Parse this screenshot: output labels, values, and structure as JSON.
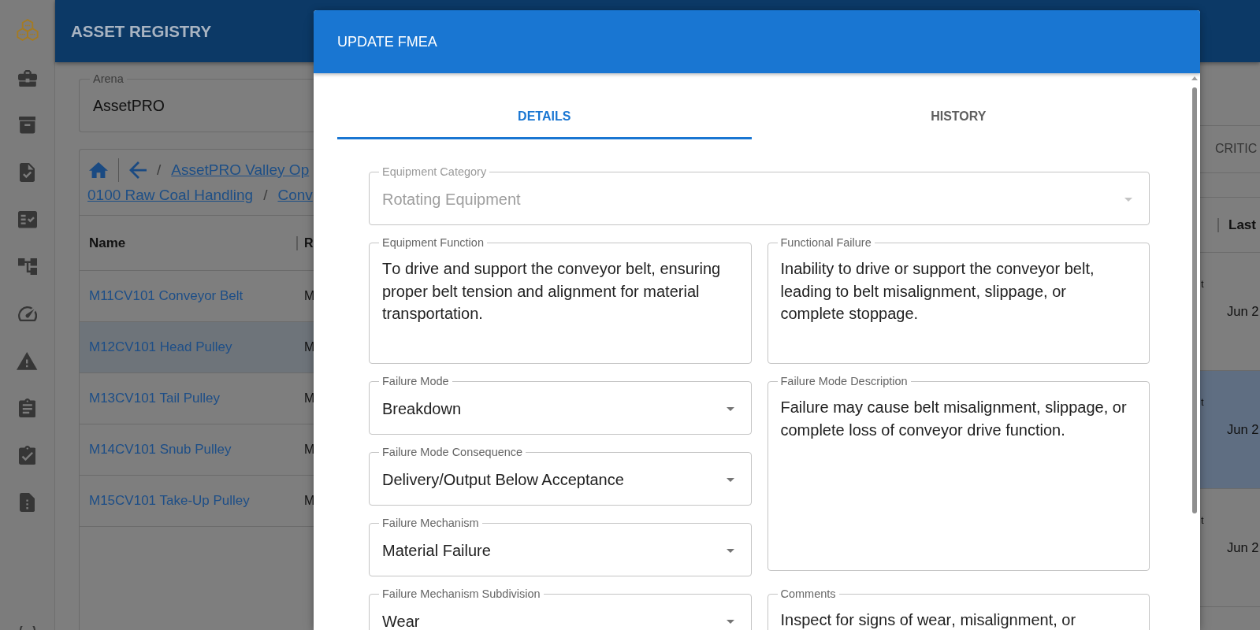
{
  "app_bar": {
    "title": "ASSET REGISTRY"
  },
  "arena": {
    "label": "Arena",
    "value": "AssetPRO"
  },
  "breadcrumb": {
    "lines": [
      [
        {
          "kind": "separator",
          "text": "/"
        },
        {
          "kind": "link",
          "text": "AssetPRO Valley Op"
        }
      ],
      [
        {
          "kind": "link",
          "text": "0100 Raw Coal Handling"
        },
        {
          "kind": "separator",
          "text": "/"
        },
        {
          "kind": "link",
          "text": "Conv"
        }
      ]
    ]
  },
  "asset_table": {
    "columns": [
      "Name",
      "R"
    ],
    "rows": [
      {
        "cells": [
          "M11CV101 Conveyor Belt",
          "M"
        ],
        "selected": false
      },
      {
        "cells": [
          "M12CV101 Head Pulley",
          "M"
        ],
        "selected": true
      },
      {
        "cells": [
          "M13CV101 Tail Pulley",
          "M"
        ],
        "selected": false
      },
      {
        "cells": [
          "M14CV101 Snub Pulley",
          "M"
        ],
        "selected": false
      },
      {
        "cells": [
          "M15CV101 Take-Up Pulley",
          "M"
        ],
        "selected": false
      }
    ]
  },
  "side_panel": {
    "tabs": [
      {
        "label": "CRITIC",
        "selected": false
      }
    ],
    "columns": [
      "",
      "Last"
    ],
    "rows": [
      {
        "cells": [
          "t",
          "Jun 2"
        ],
        "selected": false
      },
      {
        "cells": [
          "t",
          "Jun 2"
        ],
        "selected": true
      },
      {
        "cells": [
          "t",
          "Jun 2"
        ],
        "selected": false
      }
    ]
  },
  "dialog": {
    "title": "UPDATE FMEA",
    "tabs": [
      {
        "label": "DETAILS",
        "selected": true
      },
      {
        "label": "HISTORY",
        "selected": false
      }
    ],
    "sections": [
      {
        "kind": "full",
        "fields": [
          {
            "kind": "select",
            "label": "Equipment Category",
            "value": "Rotating Equipment",
            "disabled": true
          }
        ]
      },
      {
        "kind": "columns",
        "left": [
          {
            "kind": "textarea",
            "label": "Equipment Function",
            "value": "To drive and support the conveyor belt, ensuring proper belt tension and alignment for material transportation.",
            "disabled": false
          }
        ],
        "right": [
          {
            "kind": "textarea",
            "label": "Functional Failure",
            "value": "Inability to drive or support the conveyor belt, leading to belt misalignment, slippage, or complete stoppage.",
            "disabled": false
          }
        ]
      },
      {
        "kind": "columns",
        "left": [
          {
            "kind": "select",
            "label": "Failure Mode",
            "value": "Breakdown",
            "disabled": false
          },
          {
            "kind": "select",
            "label": "Failure Mode Consequence",
            "value": "Delivery/Output Below Acceptance",
            "disabled": false
          },
          {
            "kind": "select",
            "label": "Failure Mechanism",
            "value": "Material Failure",
            "disabled": false
          },
          {
            "kind": "select",
            "label": "Failure Mechanism Subdivision",
            "value": "Wear",
            "disabled": false
          }
        ],
        "right": [
          {
            "kind": "textarea",
            "label": "Failure Mode Description",
            "value": "Failure may cause belt misalignment, slippage, or complete loss of conveyor drive function.",
            "disabled": false
          },
          {
            "kind": "textarea",
            "label": "Comments",
            "value": "Inspect for signs of wear, misalignment, or",
            "disabled": false
          }
        ]
      }
    ]
  }
}
